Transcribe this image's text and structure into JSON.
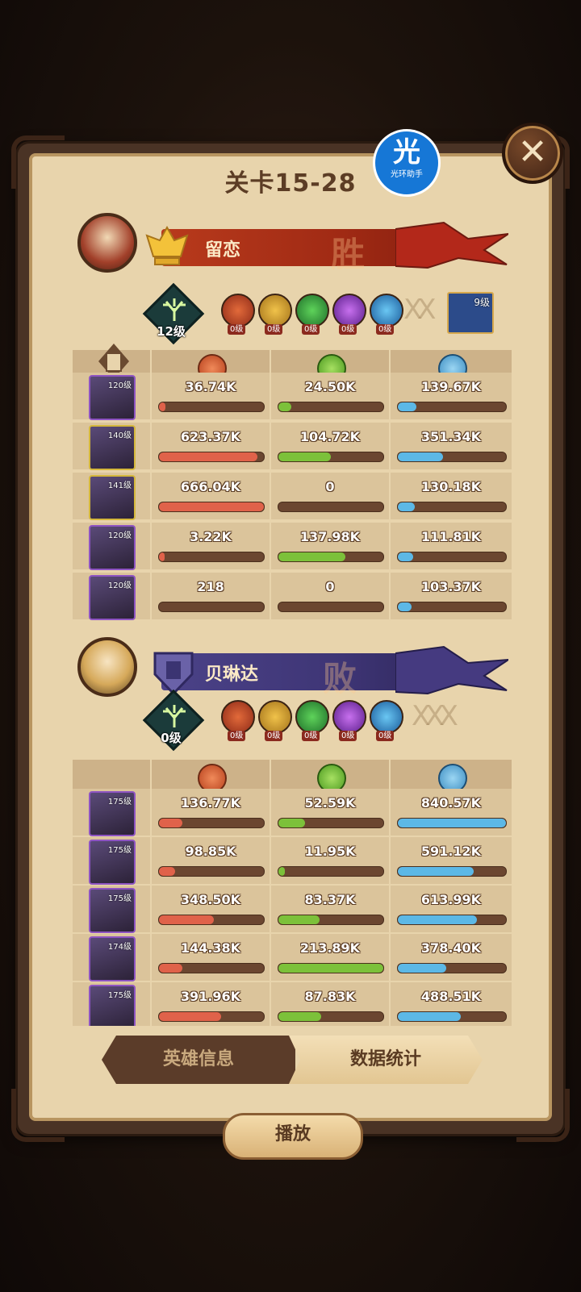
{
  "title": "关卡15-28",
  "watermark": {
    "glyph": "光",
    "text": "光环助手"
  },
  "close_icon": "close-icon",
  "colors": {
    "damage": "#e0624a",
    "heal": "#7cc13a",
    "shield": "#5cb8e6",
    "win": "#b83a1c",
    "lose": "#4b4288"
  },
  "stat_icons": [
    "damage-icon",
    "heal-icon",
    "shield-icon"
  ],
  "teams": [
    {
      "name": "留恋",
      "result": "胜",
      "tree_level": "12级",
      "pet_level": "9级",
      "factions": [
        "0级",
        "0级",
        "0级",
        "0级",
        "0级"
      ],
      "heroes": [
        {
          "level": "120级",
          "damage": "36.74K",
          "heal": "24.50K",
          "shield": "139.67K",
          "dmg_pct": 0.06,
          "heal_pct": 0.12,
          "shield_pct": 0.17
        },
        {
          "level": "140级",
          "damage": "623.37K",
          "heal": "104.72K",
          "shield": "351.34K",
          "dmg_pct": 0.94,
          "heal_pct": 0.5,
          "shield_pct": 0.42
        },
        {
          "level": "141级",
          "damage": "666.04K",
          "heal": "0",
          "shield": "130.18K",
          "dmg_pct": 1.0,
          "heal_pct": 0.0,
          "shield_pct": 0.16
        },
        {
          "level": "120级",
          "damage": "3.22K",
          "heal": "137.98K",
          "shield": "111.81K",
          "dmg_pct": 0.01,
          "heal_pct": 0.64,
          "shield_pct": 0.14
        },
        {
          "level": "120级",
          "damage": "218",
          "heal": "0",
          "shield": "103.37K",
          "dmg_pct": 0.0,
          "heal_pct": 0.0,
          "shield_pct": 0.13
        }
      ]
    },
    {
      "name": "贝琳达",
      "result": "败",
      "tree_level": "0级",
      "factions": [
        "0级",
        "0级",
        "0级",
        "0级",
        "0级"
      ],
      "heroes": [
        {
          "level": "175级",
          "damage": "136.77K",
          "heal": "52.59K",
          "shield": "840.57K",
          "dmg_pct": 0.22,
          "heal_pct": 0.25,
          "shield_pct": 1.0
        },
        {
          "level": "175级",
          "damage": "98.85K",
          "heal": "11.95K",
          "shield": "591.12K",
          "dmg_pct": 0.15,
          "heal_pct": 0.06,
          "shield_pct": 0.7
        },
        {
          "level": "175级",
          "damage": "348.50K",
          "heal": "83.37K",
          "shield": "613.99K",
          "dmg_pct": 0.52,
          "heal_pct": 0.39,
          "shield_pct": 0.73
        },
        {
          "level": "174级",
          "damage": "144.38K",
          "heal": "213.89K",
          "shield": "378.40K",
          "dmg_pct": 0.22,
          "heal_pct": 1.0,
          "shield_pct": 0.45
        },
        {
          "level": "175级",
          "damage": "391.96K",
          "heal": "87.83K",
          "shield": "488.51K",
          "dmg_pct": 0.59,
          "heal_pct": 0.41,
          "shield_pct": 0.58
        }
      ]
    }
  ],
  "tabs": {
    "hero_info": "英雄信息",
    "data_stats": "数据统计"
  },
  "play_label": "播放"
}
